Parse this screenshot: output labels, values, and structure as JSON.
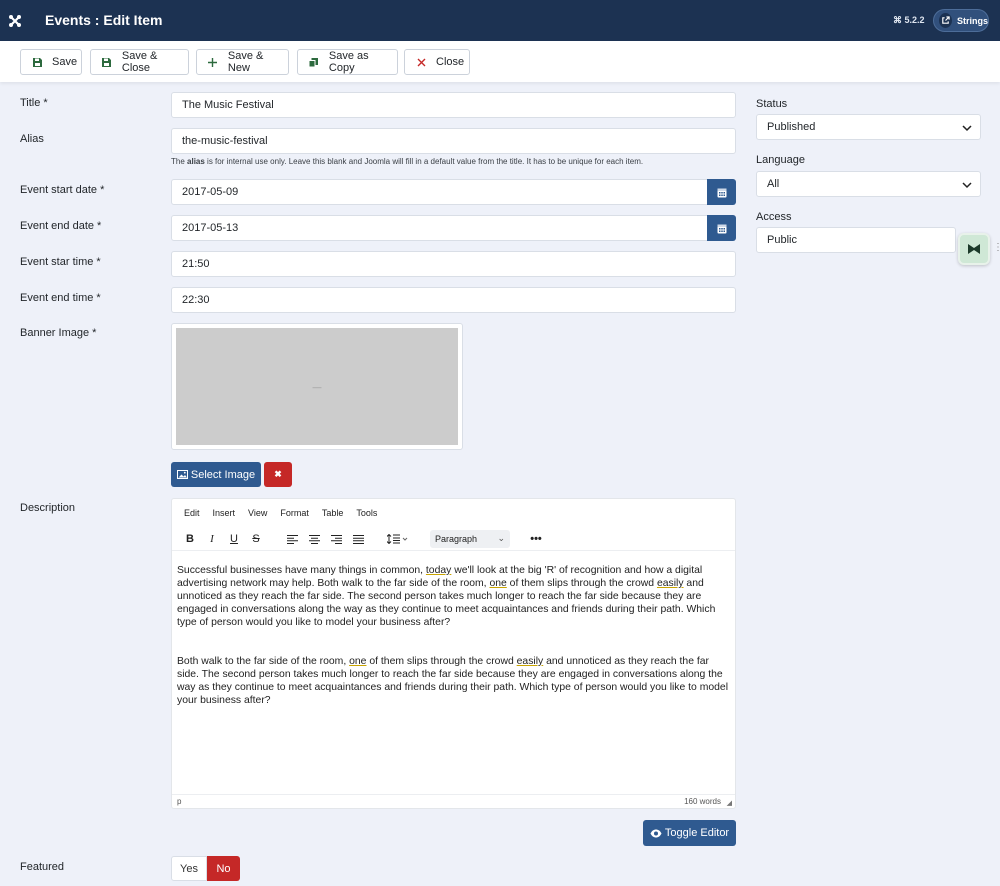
{
  "header": {
    "title": "Events : Edit Item",
    "version": "⌘ 5.2.2",
    "strings_label": "Strings"
  },
  "toolbar": {
    "save": "Save",
    "save_close": "Save & Close",
    "save_new": "Save & New",
    "save_copy": "Save as Copy",
    "close": "Close"
  },
  "form": {
    "title_label": "Title *",
    "title_value": "The Music Festival",
    "alias_label": "Alias",
    "alias_value": "the-music-festival",
    "alias_hint_pre": "The ",
    "alias_hint_bold": "alias",
    "alias_hint_post": " is for internal use only. Leave this blank and Joomla will fill in a default value from the title. It has to be unique for each item.",
    "start_date_label": "Event start date *",
    "start_date_value": "2017-05-09",
    "end_date_label": "Event end date *",
    "end_date_value": "2017-05-13",
    "start_time_label": "Event star time *",
    "start_time_value": "21:50",
    "end_time_label": "Event end time *",
    "end_time_value": "22:30",
    "banner_label": "Banner Image *",
    "banner_placeholder": "—",
    "select_image": "Select Image",
    "clear_image": "✖",
    "description_label": "Description",
    "toggle_editor": "Toggle Editor",
    "featured_label": "Featured",
    "featured_yes": "Yes",
    "featured_no": "No"
  },
  "editor": {
    "menu": [
      "Edit",
      "Insert",
      "View",
      "Format",
      "Table",
      "Tools"
    ],
    "paragraph": "Paragraph",
    "p1_a": "Successful businesses have many things in common, ",
    "p1_u1": "today",
    "p1_b": " we'll look at the big 'R' of recognition and how a digital advertising network may help. Both walk to the far side of the room, ",
    "p1_u2": "one",
    "p1_c": " of them slips through the crowd ",
    "p1_u3": "easily",
    "p1_d": " and unnoticed as they reach the far side. The second person takes much longer to reach the far side because they are engaged in conversations along the way as they continue to meet acquaintances and friends during their path. Which type of person would you like to model your business after?",
    "p2_a": "Both walk to the far side of the room, ",
    "p2_u1": "one",
    "p2_b": " of them slips through the crowd ",
    "p2_u2": "easily",
    "p2_c": " and unnoticed as they reach the far side. The second person takes much longer to reach the far side because they are engaged in conversations along the way as they continue to meet acquaintances and friends during their path. Which type of person would you like to model your business after?",
    "status_path": "p",
    "word_count": "160 words"
  },
  "sidebar": {
    "status_label": "Status",
    "status_value": "Published",
    "language_label": "Language",
    "language_value": "All",
    "access_label": "Access",
    "access_value": "Public"
  },
  "colors": {
    "header_bg": "#1c3252",
    "primary": "#2f5a90",
    "danger": "#c52827",
    "page_bg": "#eef1f9"
  }
}
